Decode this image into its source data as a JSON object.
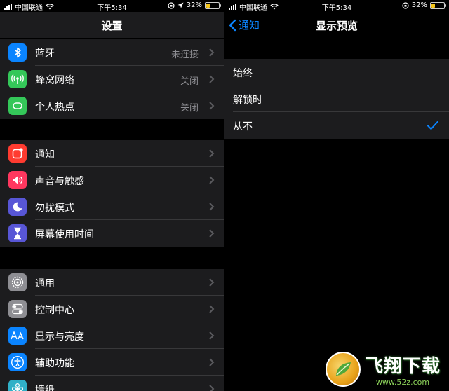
{
  "left": {
    "status": {
      "carrier": "中国联通",
      "time": "下午5:34",
      "battery": "32%",
      "battery_level": 0.32
    },
    "nav": {
      "title": "设置"
    },
    "groups": [
      [
        {
          "label": "蓝牙",
          "value": "未连接",
          "icon": "bluetooth-icon",
          "color": "#0a84ff"
        },
        {
          "label": "蜂窝网络",
          "value": "关闭",
          "icon": "antenna-icon",
          "color": "#34c759"
        },
        {
          "label": "个人热点",
          "value": "关闭",
          "icon": "hotspot-icon",
          "color": "#34c759"
        }
      ],
      [
        {
          "label": "通知",
          "value": "",
          "icon": "notification-icon",
          "color": "#ff3b30"
        },
        {
          "label": "声音与触感",
          "value": "",
          "icon": "speaker-icon",
          "color": "#ff375f"
        },
        {
          "label": "勿扰模式",
          "value": "",
          "icon": "moon-icon",
          "color": "#5856d6"
        },
        {
          "label": "屏幕使用时间",
          "value": "",
          "icon": "hourglass-icon",
          "color": "#5856d6"
        }
      ],
      [
        {
          "label": "通用",
          "value": "",
          "icon": "gear-icon",
          "color": "#8e8e93"
        },
        {
          "label": "控制中心",
          "value": "",
          "icon": "switches-icon",
          "color": "#8e8e93"
        },
        {
          "label": "显示与亮度",
          "value": "",
          "icon": "text-size-icon",
          "color": "#0a84ff"
        },
        {
          "label": "辅助功能",
          "value": "",
          "icon": "accessibility-icon",
          "color": "#0a84ff"
        },
        {
          "label": "墙纸",
          "value": "",
          "icon": "flower-icon",
          "color": "#30b0c7"
        }
      ]
    ]
  },
  "right": {
    "status": {
      "carrier": "中国联通",
      "time": "下午5:34",
      "battery": "32%",
      "battery_level": 0.32
    },
    "nav": {
      "back": "通知",
      "title": "显示预览"
    },
    "options": [
      {
        "label": "始终",
        "selected": false
      },
      {
        "label": "解锁时",
        "selected": false
      },
      {
        "label": "从不",
        "selected": true
      }
    ]
  },
  "watermark": {
    "brand": "飞翔下载",
    "url": "www.52z.com"
  },
  "colors": {
    "accent": "#0a84ff",
    "cell_bg": "#1c1c1e",
    "separator": "#38383a"
  }
}
